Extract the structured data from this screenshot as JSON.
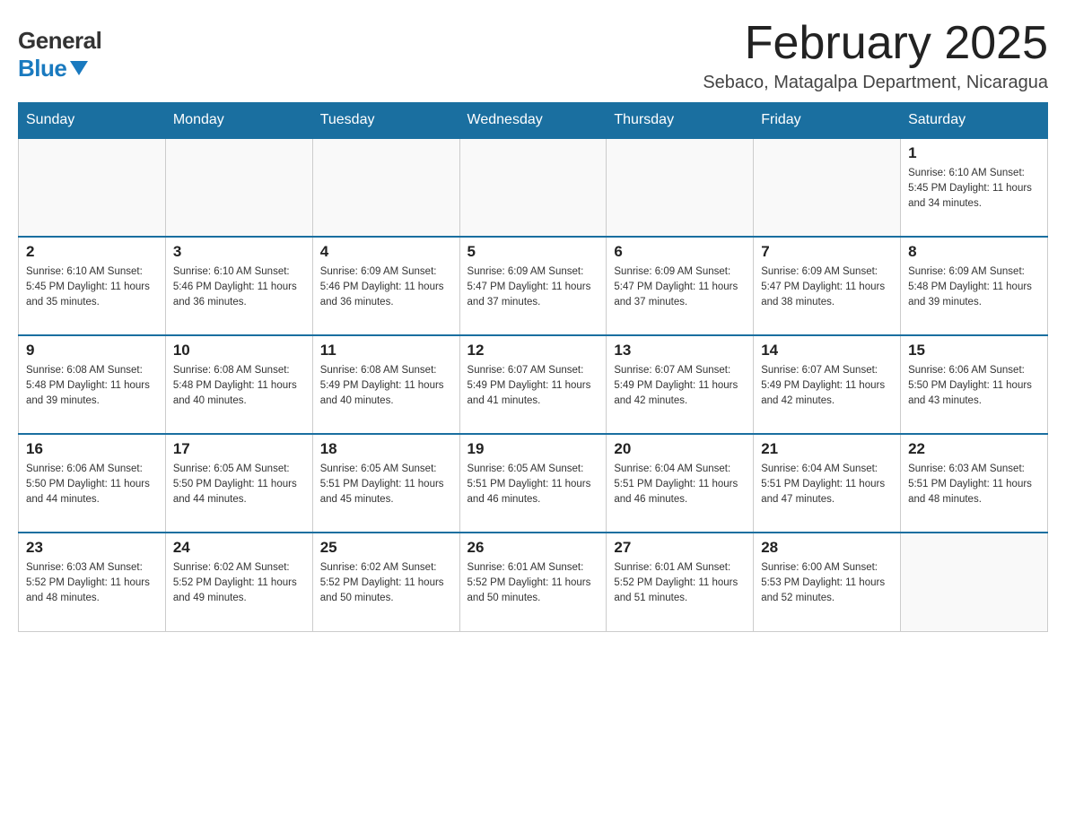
{
  "header": {
    "logo_general": "General",
    "logo_blue": "Blue",
    "month_title": "February 2025",
    "location": "Sebaco, Matagalpa Department, Nicaragua"
  },
  "days_of_week": [
    "Sunday",
    "Monday",
    "Tuesday",
    "Wednesday",
    "Thursday",
    "Friday",
    "Saturday"
  ],
  "weeks": [
    [
      {
        "day": "",
        "info": ""
      },
      {
        "day": "",
        "info": ""
      },
      {
        "day": "",
        "info": ""
      },
      {
        "day": "",
        "info": ""
      },
      {
        "day": "",
        "info": ""
      },
      {
        "day": "",
        "info": ""
      },
      {
        "day": "1",
        "info": "Sunrise: 6:10 AM\nSunset: 5:45 PM\nDaylight: 11 hours\nand 34 minutes."
      }
    ],
    [
      {
        "day": "2",
        "info": "Sunrise: 6:10 AM\nSunset: 5:45 PM\nDaylight: 11 hours\nand 35 minutes."
      },
      {
        "day": "3",
        "info": "Sunrise: 6:10 AM\nSunset: 5:46 PM\nDaylight: 11 hours\nand 36 minutes."
      },
      {
        "day": "4",
        "info": "Sunrise: 6:09 AM\nSunset: 5:46 PM\nDaylight: 11 hours\nand 36 minutes."
      },
      {
        "day": "5",
        "info": "Sunrise: 6:09 AM\nSunset: 5:47 PM\nDaylight: 11 hours\nand 37 minutes."
      },
      {
        "day": "6",
        "info": "Sunrise: 6:09 AM\nSunset: 5:47 PM\nDaylight: 11 hours\nand 37 minutes."
      },
      {
        "day": "7",
        "info": "Sunrise: 6:09 AM\nSunset: 5:47 PM\nDaylight: 11 hours\nand 38 minutes."
      },
      {
        "day": "8",
        "info": "Sunrise: 6:09 AM\nSunset: 5:48 PM\nDaylight: 11 hours\nand 39 minutes."
      }
    ],
    [
      {
        "day": "9",
        "info": "Sunrise: 6:08 AM\nSunset: 5:48 PM\nDaylight: 11 hours\nand 39 minutes."
      },
      {
        "day": "10",
        "info": "Sunrise: 6:08 AM\nSunset: 5:48 PM\nDaylight: 11 hours\nand 40 minutes."
      },
      {
        "day": "11",
        "info": "Sunrise: 6:08 AM\nSunset: 5:49 PM\nDaylight: 11 hours\nand 40 minutes."
      },
      {
        "day": "12",
        "info": "Sunrise: 6:07 AM\nSunset: 5:49 PM\nDaylight: 11 hours\nand 41 minutes."
      },
      {
        "day": "13",
        "info": "Sunrise: 6:07 AM\nSunset: 5:49 PM\nDaylight: 11 hours\nand 42 minutes."
      },
      {
        "day": "14",
        "info": "Sunrise: 6:07 AM\nSunset: 5:49 PM\nDaylight: 11 hours\nand 42 minutes."
      },
      {
        "day": "15",
        "info": "Sunrise: 6:06 AM\nSunset: 5:50 PM\nDaylight: 11 hours\nand 43 minutes."
      }
    ],
    [
      {
        "day": "16",
        "info": "Sunrise: 6:06 AM\nSunset: 5:50 PM\nDaylight: 11 hours\nand 44 minutes."
      },
      {
        "day": "17",
        "info": "Sunrise: 6:05 AM\nSunset: 5:50 PM\nDaylight: 11 hours\nand 44 minutes."
      },
      {
        "day": "18",
        "info": "Sunrise: 6:05 AM\nSunset: 5:51 PM\nDaylight: 11 hours\nand 45 minutes."
      },
      {
        "day": "19",
        "info": "Sunrise: 6:05 AM\nSunset: 5:51 PM\nDaylight: 11 hours\nand 46 minutes."
      },
      {
        "day": "20",
        "info": "Sunrise: 6:04 AM\nSunset: 5:51 PM\nDaylight: 11 hours\nand 46 minutes."
      },
      {
        "day": "21",
        "info": "Sunrise: 6:04 AM\nSunset: 5:51 PM\nDaylight: 11 hours\nand 47 minutes."
      },
      {
        "day": "22",
        "info": "Sunrise: 6:03 AM\nSunset: 5:51 PM\nDaylight: 11 hours\nand 48 minutes."
      }
    ],
    [
      {
        "day": "23",
        "info": "Sunrise: 6:03 AM\nSunset: 5:52 PM\nDaylight: 11 hours\nand 48 minutes."
      },
      {
        "day": "24",
        "info": "Sunrise: 6:02 AM\nSunset: 5:52 PM\nDaylight: 11 hours\nand 49 minutes."
      },
      {
        "day": "25",
        "info": "Sunrise: 6:02 AM\nSunset: 5:52 PM\nDaylight: 11 hours\nand 50 minutes."
      },
      {
        "day": "26",
        "info": "Sunrise: 6:01 AM\nSunset: 5:52 PM\nDaylight: 11 hours\nand 50 minutes."
      },
      {
        "day": "27",
        "info": "Sunrise: 6:01 AM\nSunset: 5:52 PM\nDaylight: 11 hours\nand 51 minutes."
      },
      {
        "day": "28",
        "info": "Sunrise: 6:00 AM\nSunset: 5:53 PM\nDaylight: 11 hours\nand 52 minutes."
      },
      {
        "day": "",
        "info": ""
      }
    ]
  ]
}
